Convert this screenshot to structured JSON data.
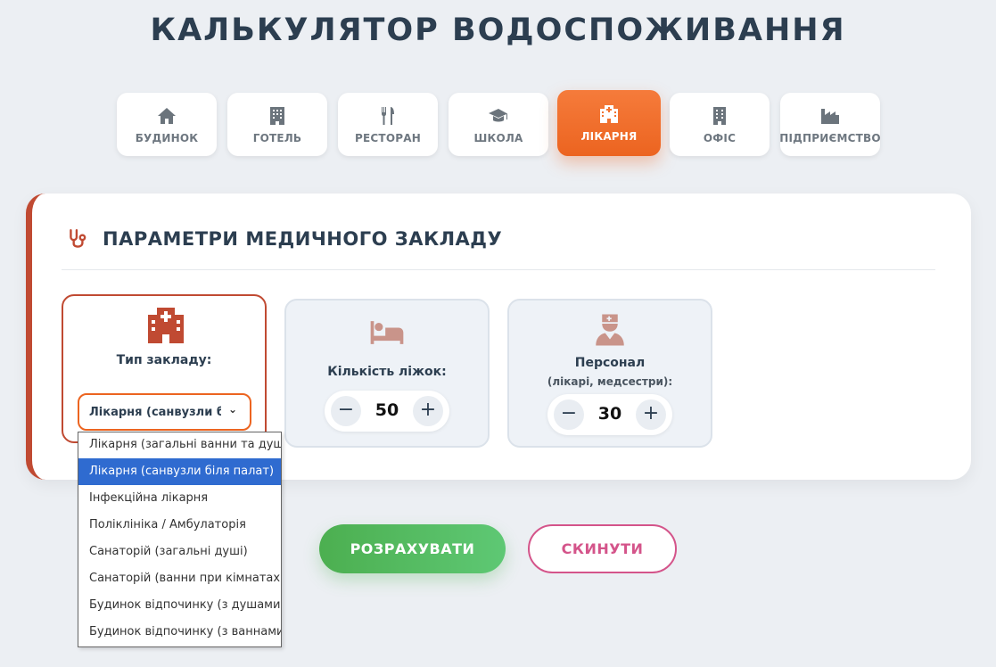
{
  "page": {
    "title": "КАЛЬКУЛЯТОР ВОДОСПОЖИВАННЯ"
  },
  "tabs": [
    {
      "label": "БУДИНОК",
      "icon": "house-icon"
    },
    {
      "label": "ГОТЕЛЬ",
      "icon": "hotel-building-icon"
    },
    {
      "label": "РЕСТОРАН",
      "icon": "fork-knife-icon"
    },
    {
      "label": "ШКОЛА",
      "icon": "graduation-cap-icon"
    },
    {
      "label": "ЛІКАРНЯ",
      "icon": "hospital-icon",
      "active": true
    },
    {
      "label": "ОФІС",
      "icon": "office-building-icon"
    },
    {
      "label": "ПІДПРИЄМСТВО",
      "icon": "factory-icon"
    }
  ],
  "section": {
    "title": "ПАРАМЕТРИ МЕДИЧНОГО ЗАКЛАДУ",
    "icon": "stethoscope-icon",
    "accent_color": "#c04a32"
  },
  "fields": {
    "facility_type": {
      "label": "Тип закладу:",
      "icon": "hospital-icon",
      "selected_value": "Лікарня (санвузли бі..."
    },
    "beds": {
      "label": "Кількість ліжок:",
      "icon": "bed-icon",
      "value": "50",
      "minus": "−",
      "plus": "+"
    },
    "staff": {
      "label": "Персонал",
      "sublabel": "(лікарі, медсестри):",
      "icon": "nurse-icon",
      "value": "30",
      "minus": "−",
      "plus": "+"
    }
  },
  "dropdown": {
    "options": [
      "Лікарня (загальні ванни та душові)",
      "Лікарня (санвузли біля палат)",
      "Інфекційна лікарня",
      "Поліклініка / Амбулаторія",
      "Санаторій (загальні душі)",
      "Санаторій (ванни при кімнатах)",
      "Будинок відпочинку (з душами)",
      "Будинок відпочинку (з ваннами)"
    ],
    "highlighted_option": "Лікарня (санвузли біля палат)"
  },
  "actions": {
    "calculate_label": "РОЗРАХУВАТИ",
    "reset_label": "СКИНУТИ"
  },
  "colors": {
    "active_tab": "#ec6420",
    "calculate": "#4caf50",
    "reset": "#d4548a",
    "dropdown_highlight": "#2f6bd0"
  }
}
